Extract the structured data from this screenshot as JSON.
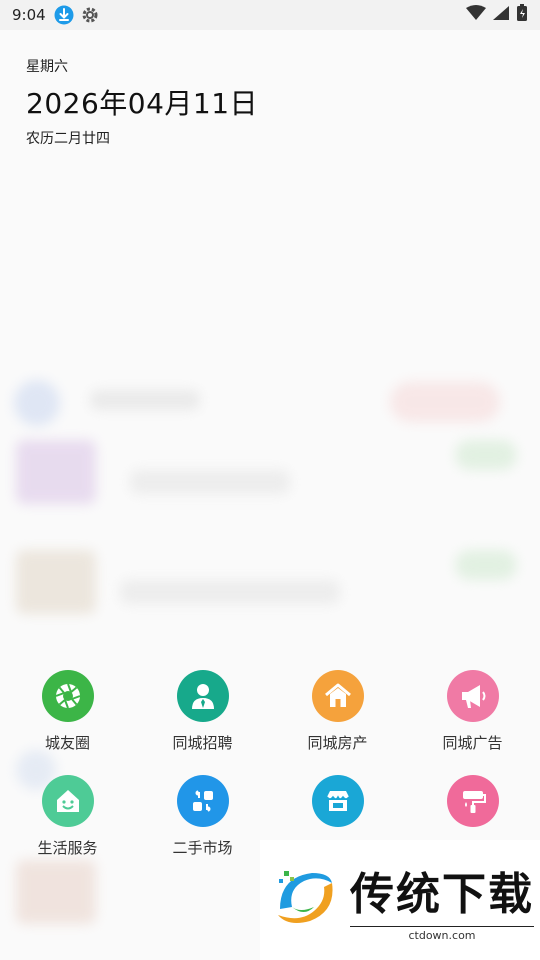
{
  "status_bar": {
    "time": "9:04",
    "icons": [
      "download-icon",
      "settings-icon",
      "wifi-icon",
      "signal-icon",
      "battery-charging-icon"
    ]
  },
  "date_header": {
    "weekday": "星期六",
    "date": "2026年04月11日",
    "lunar": "农历二月廿四"
  },
  "shortcuts": [
    {
      "label": "城友圈",
      "icon": "camera-aperture-icon",
      "color": "#3cb547"
    },
    {
      "label": "同城招聘",
      "icon": "person-tie-icon",
      "color": "#17a98b"
    },
    {
      "label": "同城房产",
      "icon": "house-icon",
      "color": "#f5a23c"
    },
    {
      "label": "同城广告",
      "icon": "megaphone-icon",
      "color": "#f07aa5"
    },
    {
      "label": "生活服务",
      "icon": "smiling-house-icon",
      "color": "#4ecb96"
    },
    {
      "label": "二手市场",
      "icon": "exchange-icon",
      "color": "#2196e8"
    },
    {
      "label": "",
      "icon": "storefront-icon",
      "color": "#1aa7d6"
    },
    {
      "label": "",
      "icon": "paint-roller-icon",
      "color": "#f06a9a"
    }
  ],
  "watermark": {
    "title": "传统下载",
    "url": "ctdown.com"
  }
}
